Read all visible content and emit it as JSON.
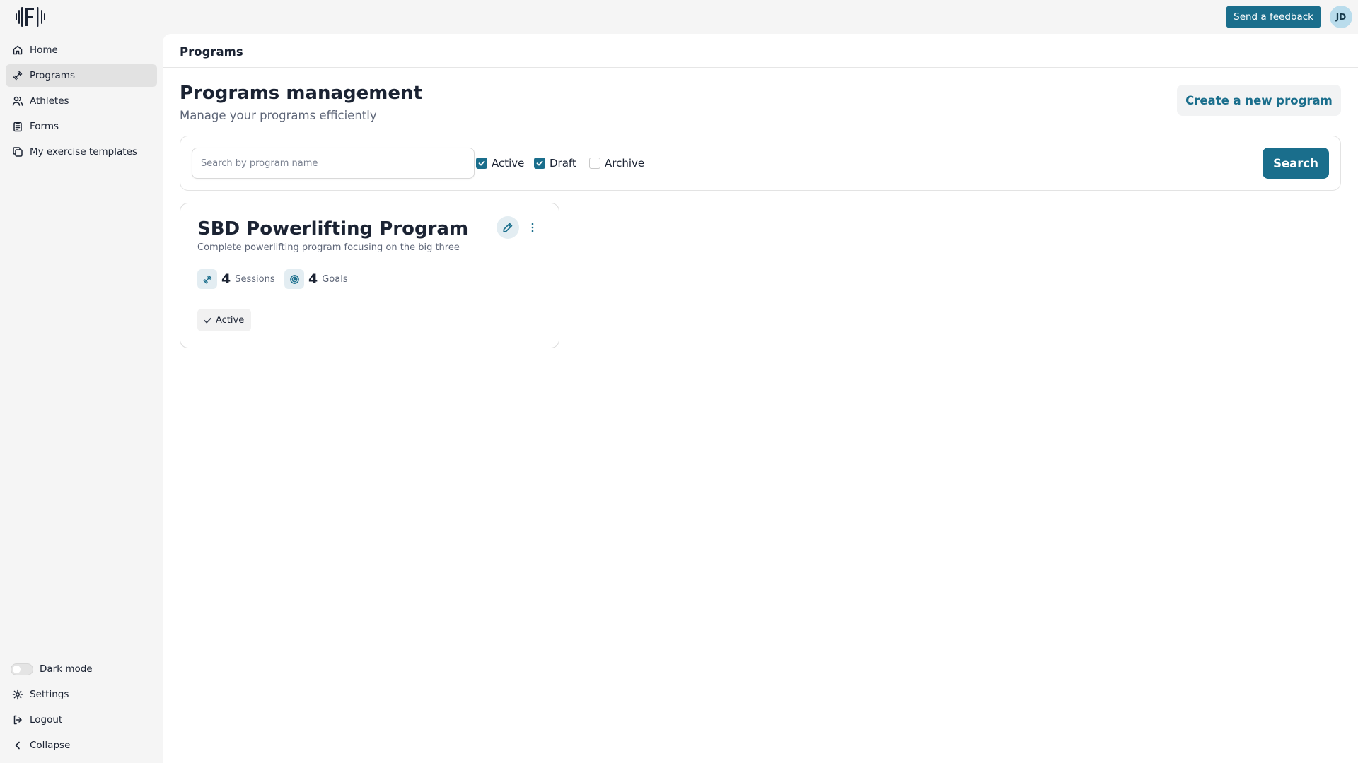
{
  "header": {
    "feedback_label": "Send a feedback",
    "avatar_initials": "JD"
  },
  "sidebar": {
    "items": [
      {
        "label": "Home",
        "icon": "home-icon"
      },
      {
        "label": "Programs",
        "icon": "dumbbell-icon",
        "active": true
      },
      {
        "label": "Athletes",
        "icon": "users-icon"
      },
      {
        "label": "Forms",
        "icon": "clipboard-icon"
      },
      {
        "label": "My exercise templates",
        "icon": "copy-icon"
      }
    ],
    "bottom": {
      "dark_mode_label": "Dark mode",
      "dark_mode_on": false,
      "settings_label": "Settings",
      "logout_label": "Logout",
      "collapse_label": "Collapse"
    }
  },
  "main": {
    "breadcrumb_title": "Programs",
    "title": "Programs management",
    "subtitle": "Manage your programs efficiently",
    "create_label": "Create a new program",
    "search": {
      "placeholder": "Search by program name",
      "value": "",
      "button_label": "Search"
    },
    "filters": [
      {
        "label": "Active",
        "checked": true
      },
      {
        "label": "Draft",
        "checked": true
      },
      {
        "label": "Archive",
        "checked": false
      }
    ],
    "programs": [
      {
        "title": "SBD Powerlifting Program",
        "description": "Complete powerlifting program focusing on the big three",
        "sessions_count": "4",
        "sessions_label": "Sessions",
        "goals_count": "4",
        "goals_label": "Goals",
        "status": "Active"
      }
    ]
  },
  "colors": {
    "accent": "#1a6e8c",
    "sidebar_bg": "#f5f5f5",
    "active_nav_bg": "#e2e2e2"
  }
}
